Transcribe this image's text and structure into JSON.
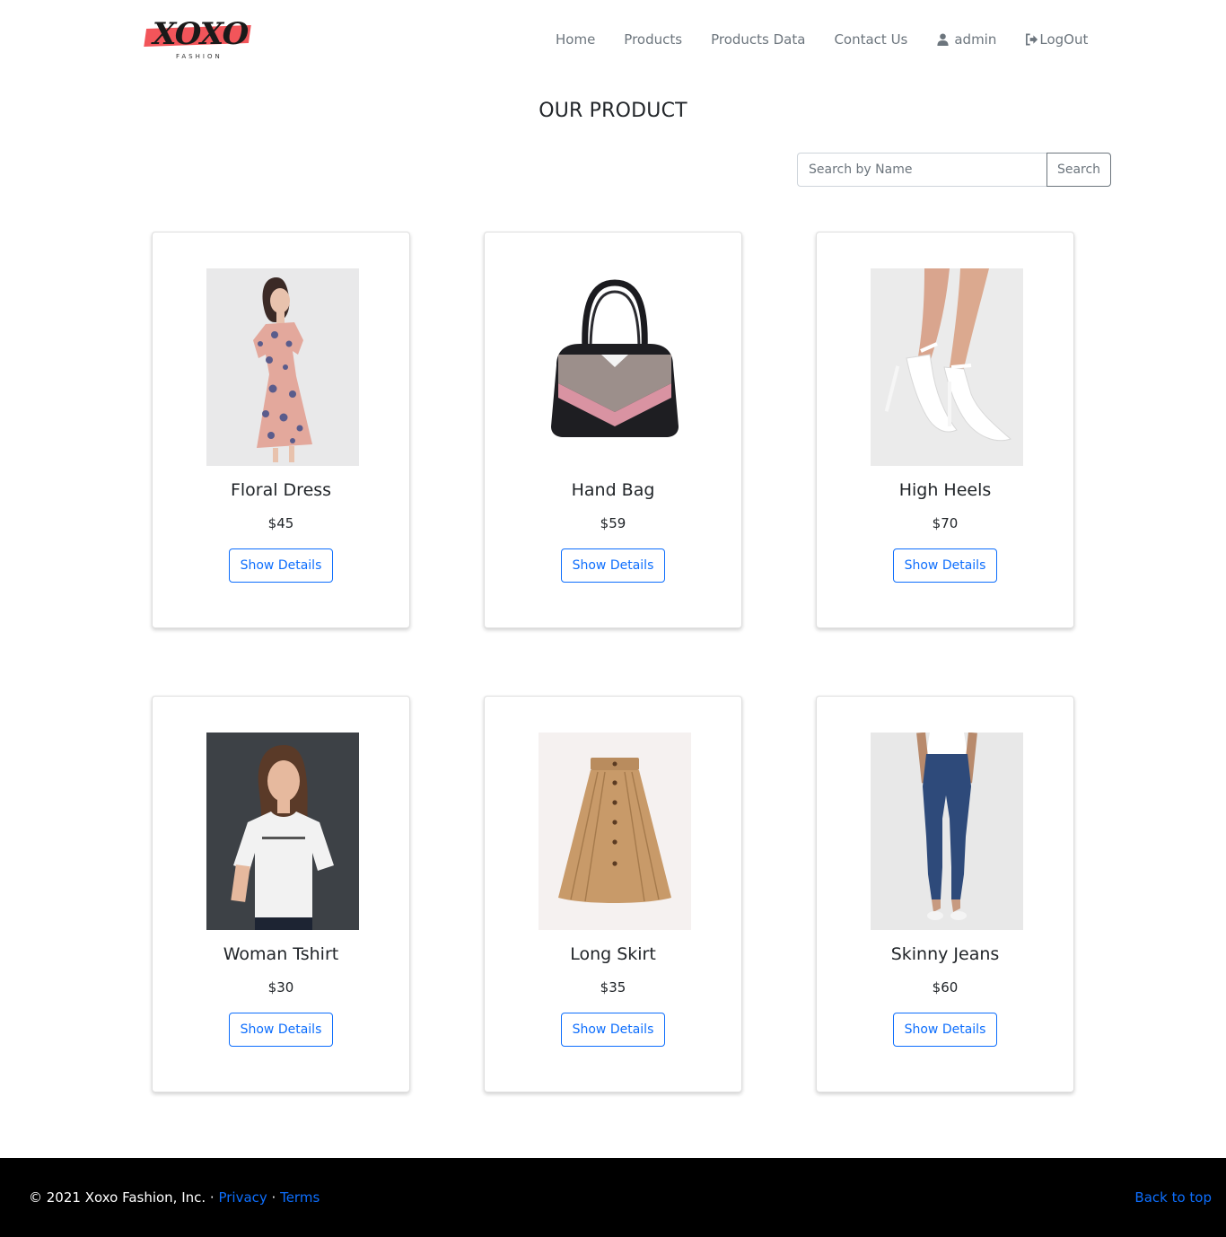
{
  "brand": {
    "logo_text": "XOXO",
    "logo_sub": "FASHION"
  },
  "nav": {
    "home": "Home",
    "products": "Products",
    "products_data": "Products Data",
    "contact": "Contact Us",
    "user": "admin",
    "logout": "LogOut"
  },
  "page_title": "OUR PRODUCT",
  "search": {
    "placeholder": "Search by Name",
    "button": "Search"
  },
  "products": [
    {
      "name": "Floral Dress",
      "price": "$45",
      "button": "Show Details"
    },
    {
      "name": "Hand Bag",
      "price": "$59",
      "button": "Show Details"
    },
    {
      "name": "High Heels",
      "price": "$70",
      "button": "Show Details"
    },
    {
      "name": "Woman Tshirt",
      "price": "$30",
      "button": "Show Details"
    },
    {
      "name": "Long Skirt",
      "price": "$35",
      "button": "Show Details"
    },
    {
      "name": "Skinny Jeans",
      "price": "$60",
      "button": "Show Details"
    }
  ],
  "footer": {
    "copyright": "© 2021 Xoxo Fashion, Inc. · ",
    "privacy": "Privacy",
    "separator": " · ",
    "terms": "Terms",
    "back_to_top": "Back to top"
  },
  "colors": {
    "accent": "#0d6efd",
    "logo_stripe": "#f2555a",
    "footer_bg": "#000000"
  }
}
